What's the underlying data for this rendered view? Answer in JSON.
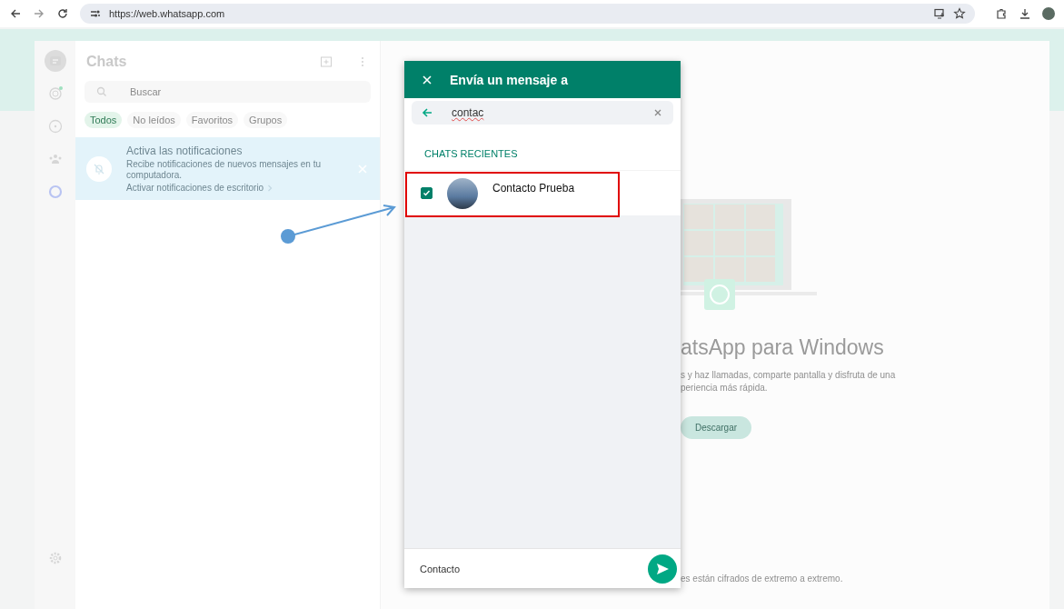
{
  "browser": {
    "url": "https://web.whatsapp.com"
  },
  "nav_rail": [
    {
      "kind": "chats",
      "selected": true
    },
    {
      "kind": "status",
      "selected": false
    },
    {
      "kind": "channels",
      "selected": false
    },
    {
      "kind": "communities",
      "selected": false
    },
    {
      "kind": "meta",
      "selected": false
    },
    {
      "kind": "settings",
      "selected": false
    }
  ],
  "chats_panel": {
    "title": "Chats",
    "search": {
      "placeholder": "Buscar"
    },
    "filters": [
      {
        "label": "Todos",
        "selected": true
      },
      {
        "label": "No leídos",
        "selected": false
      },
      {
        "label": "Favoritos",
        "selected": false
      },
      {
        "label": "Grupos",
        "selected": false
      }
    ],
    "notification": {
      "title": "Activa las notificaciones",
      "text": "Recibe notificaciones de nuevos mensajes en tu computadora.",
      "link": "Activar notificaciones de escritorio"
    }
  },
  "intro": {
    "title": "atsApp para Windows",
    "text_lines": [
      "s y haz llamadas, comparte pantalla y disfruta de una",
      "periencia más rápida."
    ],
    "button": "Descargar",
    "footer": "es están cifrados de extremo a extremo."
  },
  "dialog": {
    "title": "Envía un mensaje a",
    "search": {
      "value": "contac"
    },
    "section": "CHATS RECIENTES",
    "contacts": [
      {
        "name": "Contacto Prueba",
        "checked": true
      }
    ],
    "footer": {
      "selected_names": "Contacto"
    }
  }
}
